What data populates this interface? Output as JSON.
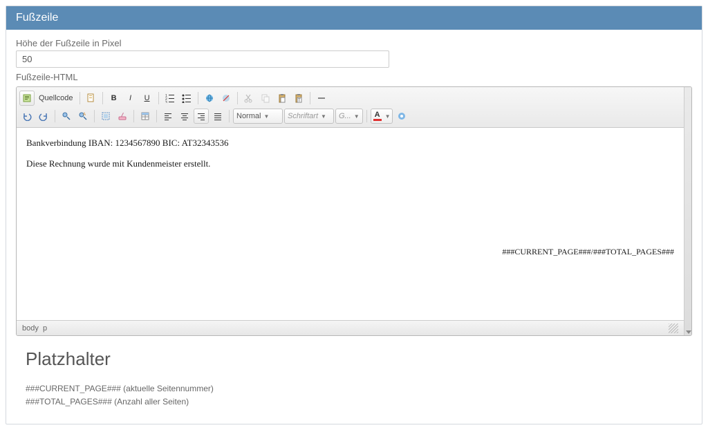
{
  "panel": {
    "title": "Fußzeile"
  },
  "heightField": {
    "label": "Höhe der Fußzeile in Pixel",
    "value": "50"
  },
  "htmlLabel": "Fußzeile-HTML",
  "toolbar": {
    "source_label": "Quellcode",
    "format_combo": "Normal",
    "font_combo": "Schriftart",
    "size_combo": "G...",
    "textcolor": "A"
  },
  "editor": {
    "line1": "Bankverbindung IBAN: 1234567890 BIC: AT32343536",
    "line2": "Diese Rechnung wurde mit Kundenmeister erstellt.",
    "page_token": "###CURRENT_PAGE###/###TOTAL_PAGES###",
    "breadcrumb_body": "body",
    "breadcrumb_p": "p"
  },
  "placeholders": {
    "heading": "Platzhalter",
    "line1": "###CURRENT_PAGE### (aktuelle Seitennummer)",
    "line2": "###TOTAL_PAGES### (Anzahl aller Seiten)"
  }
}
